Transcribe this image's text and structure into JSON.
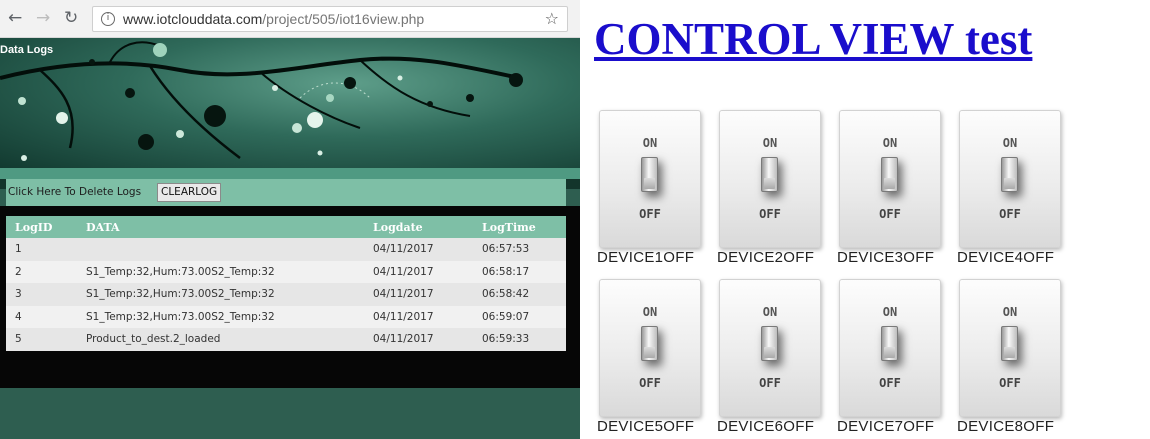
{
  "browser": {
    "back_icon": "back-arrow-icon",
    "forward_icon": "forward-arrow-icon",
    "reload_icon": "reload-icon",
    "info_icon": "info-icon",
    "bookmark_icon": "star-icon",
    "url_host": "www.iotclouddata.com",
    "url_path": "/project/505/iot16view.php"
  },
  "datalogs": {
    "title": "Data Logs",
    "clear_label": "Click Here To Delete Logs",
    "clear_button": "CLEARLOG",
    "columns": [
      "LogID",
      "DATA",
      "Logdate",
      "LogTime"
    ],
    "rows": [
      {
        "id": "1",
        "data": "",
        "date": "04/11/2017",
        "time": "06:57:53"
      },
      {
        "id": "2",
        "data": "S1_Temp:32,Hum:73.00S2_Temp:32",
        "date": "04/11/2017",
        "time": "06:58:17"
      },
      {
        "id": "3",
        "data": "S1_Temp:32,Hum:73.00S2_Temp:32",
        "date": "04/11/2017",
        "time": "06:58:42"
      },
      {
        "id": "4",
        "data": "S1_Temp:32,Hum:73.00S2_Temp:32",
        "date": "04/11/2017",
        "time": "06:59:07"
      },
      {
        "id": "5",
        "data": "Product_to_dest.2_loaded",
        "date": "04/11/2017",
        "time": "06:59:33"
      }
    ]
  },
  "control": {
    "title": "CONTROL VIEW test",
    "switch_on_label": "ON",
    "switch_off_label": "OFF",
    "devices": [
      {
        "label": "DEVICE1OFF",
        "state": "OFF"
      },
      {
        "label": "DEVICE2OFF",
        "state": "OFF"
      },
      {
        "label": "DEVICE3OFF",
        "state": "OFF"
      },
      {
        "label": "DEVICE4OFF",
        "state": "OFF"
      },
      {
        "label": "DEVICE5OFF",
        "state": "OFF"
      },
      {
        "label": "DEVICE6OFF",
        "state": "OFF"
      },
      {
        "label": "DEVICE7OFF",
        "state": "OFF"
      },
      {
        "label": "DEVICE8OFF",
        "state": "OFF"
      }
    ]
  },
  "colors": {
    "table_header": "#7ebfa6",
    "banner_dark": "#123a30",
    "link_blue": "#1a0dcc"
  }
}
